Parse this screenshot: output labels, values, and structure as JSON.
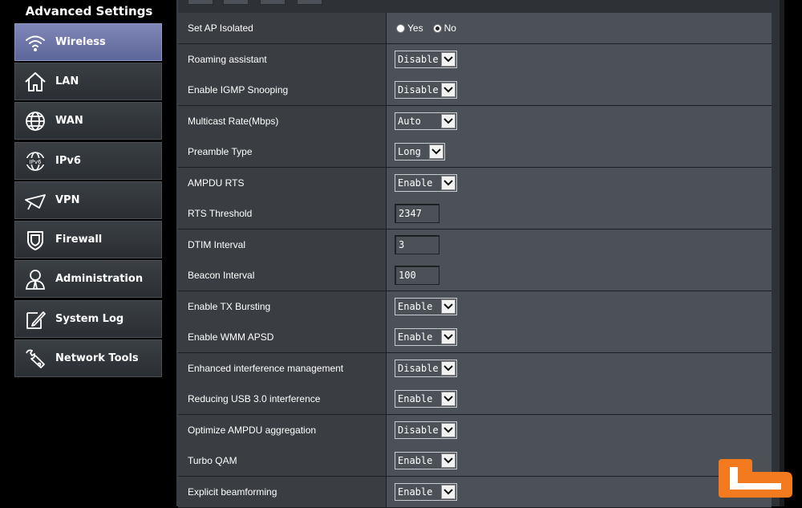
{
  "sidebar": {
    "title": "Advanced Settings",
    "items": [
      {
        "label": "Wireless",
        "icon": "wifi-icon"
      },
      {
        "label": "LAN",
        "icon": "home-icon"
      },
      {
        "label": "WAN",
        "icon": "globe-icon"
      },
      {
        "label": "IPv6",
        "icon": "ipv6-icon"
      },
      {
        "label": "VPN",
        "icon": "vpn-icon"
      },
      {
        "label": "Firewall",
        "icon": "shield-icon"
      },
      {
        "label": "Administration",
        "icon": "user-icon"
      },
      {
        "label": "System Log",
        "icon": "edit-icon"
      },
      {
        "label": "Network Tools",
        "icon": "tools-icon"
      }
    ]
  },
  "settings": {
    "ap_isolated": {
      "label": "Set AP Isolated",
      "options": [
        "Yes",
        "No"
      ],
      "selected": "No"
    },
    "roaming": {
      "label": "Roaming assistant",
      "value": "Disable"
    },
    "igmp": {
      "label": "Enable IGMP Snooping",
      "value": "Disable"
    },
    "multicast": {
      "label": "Multicast Rate(Mbps)",
      "value": "Auto"
    },
    "preamble": {
      "label": "Preamble Type",
      "value": "Long"
    },
    "ampdu_rts": {
      "label": "AMPDU RTS",
      "value": "Enable"
    },
    "rts_threshold": {
      "label": "RTS Threshold",
      "value": "2347"
    },
    "dtim": {
      "label": "DTIM Interval",
      "value": "3"
    },
    "beacon": {
      "label": "Beacon Interval",
      "value": "100"
    },
    "tx_bursting": {
      "label": "Enable TX Bursting",
      "value": "Enable"
    },
    "wmm_apsd": {
      "label": "Enable WMM APSD",
      "value": "Enable"
    },
    "interference": {
      "label": "Enhanced interference management",
      "value": "Disable"
    },
    "usb3": {
      "label": "Reducing USB 3.0 interference",
      "value": "Enable"
    },
    "ampdu_agg": {
      "label": "Optimize AMPDU aggregation",
      "value": "Disable"
    },
    "turbo_qam": {
      "label": "Turbo QAM",
      "value": "Enable"
    },
    "beamforming": {
      "label": "Explicit beamforming",
      "value": "Enable"
    }
  },
  "colors": {
    "active_item": "#6b74a8",
    "logo_orange": "#f47a20"
  }
}
